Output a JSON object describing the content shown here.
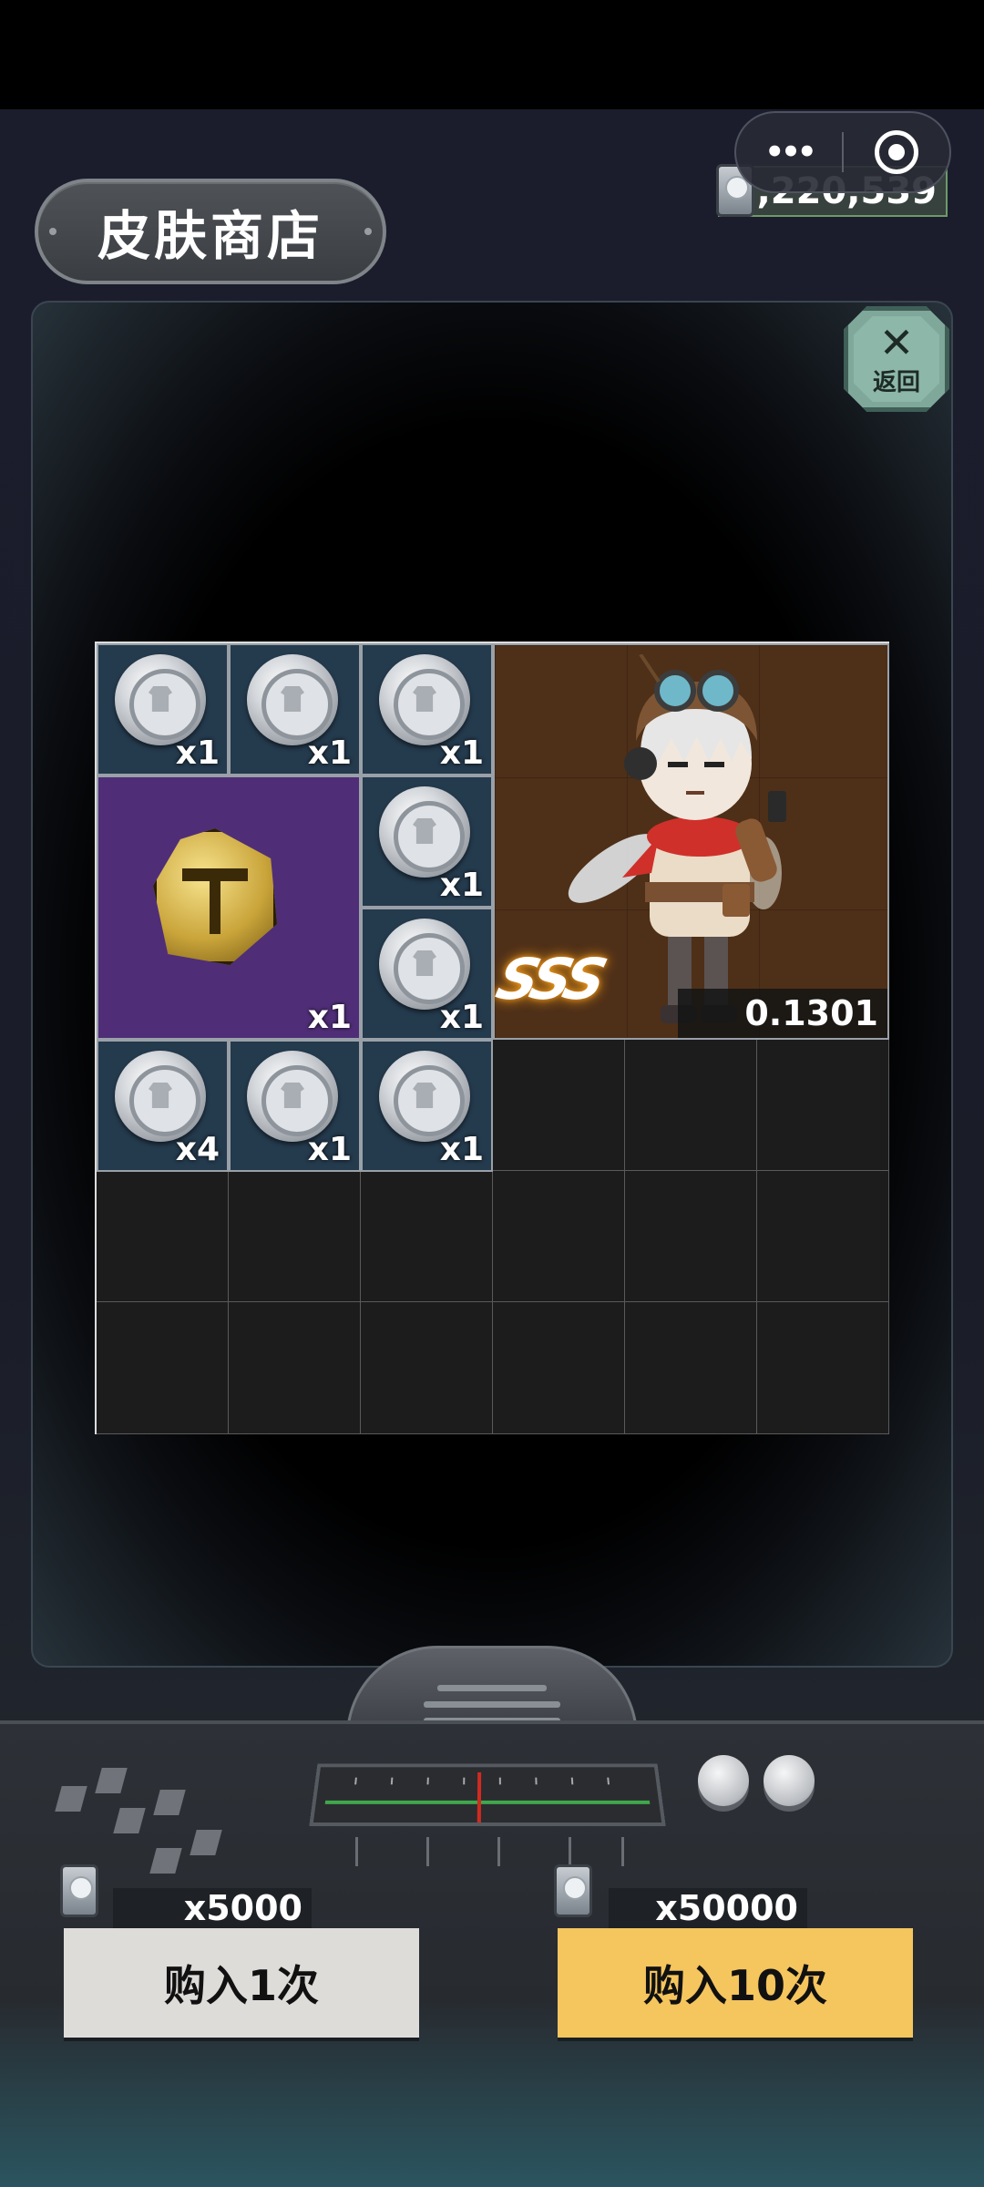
{
  "header": {
    "title": "皮肤商店",
    "balance": "1,220,539"
  },
  "capsule": {
    "more_label": "•••"
  },
  "back_button": {
    "icon": "close-x-icon",
    "label": "返回"
  },
  "grid": {
    "rows": 6,
    "cols": 6,
    "items": [
      {
        "type": "coin",
        "qty": "x1"
      },
      {
        "type": "coin",
        "qty": "x1"
      },
      {
        "type": "coin",
        "qty": "x1"
      },
      {
        "type": "character",
        "rarity": "SSS",
        "odds": "0.1301"
      },
      {
        "type": "gold-badge",
        "qty": "x1"
      },
      {
        "type": "coin",
        "qty": "x1"
      },
      {
        "type": "coin",
        "qty": "x1"
      },
      {
        "type": "coin",
        "qty": "x4"
      },
      {
        "type": "coin",
        "qty": "x1"
      },
      {
        "type": "coin",
        "qty": "x1"
      }
    ]
  },
  "purchase": {
    "single": {
      "price": "x5000",
      "label": "购入1次"
    },
    "ten": {
      "price": "x50000",
      "label": "购入10次"
    }
  },
  "colors": {
    "buy_single_bg": "#dedcd9",
    "buy_ten_bg": "#f5c55e",
    "coin_cell_bg": "#243a4d",
    "gold_cell_bg": "#4f2e77",
    "char_cell_bg": "#4e2f18"
  }
}
